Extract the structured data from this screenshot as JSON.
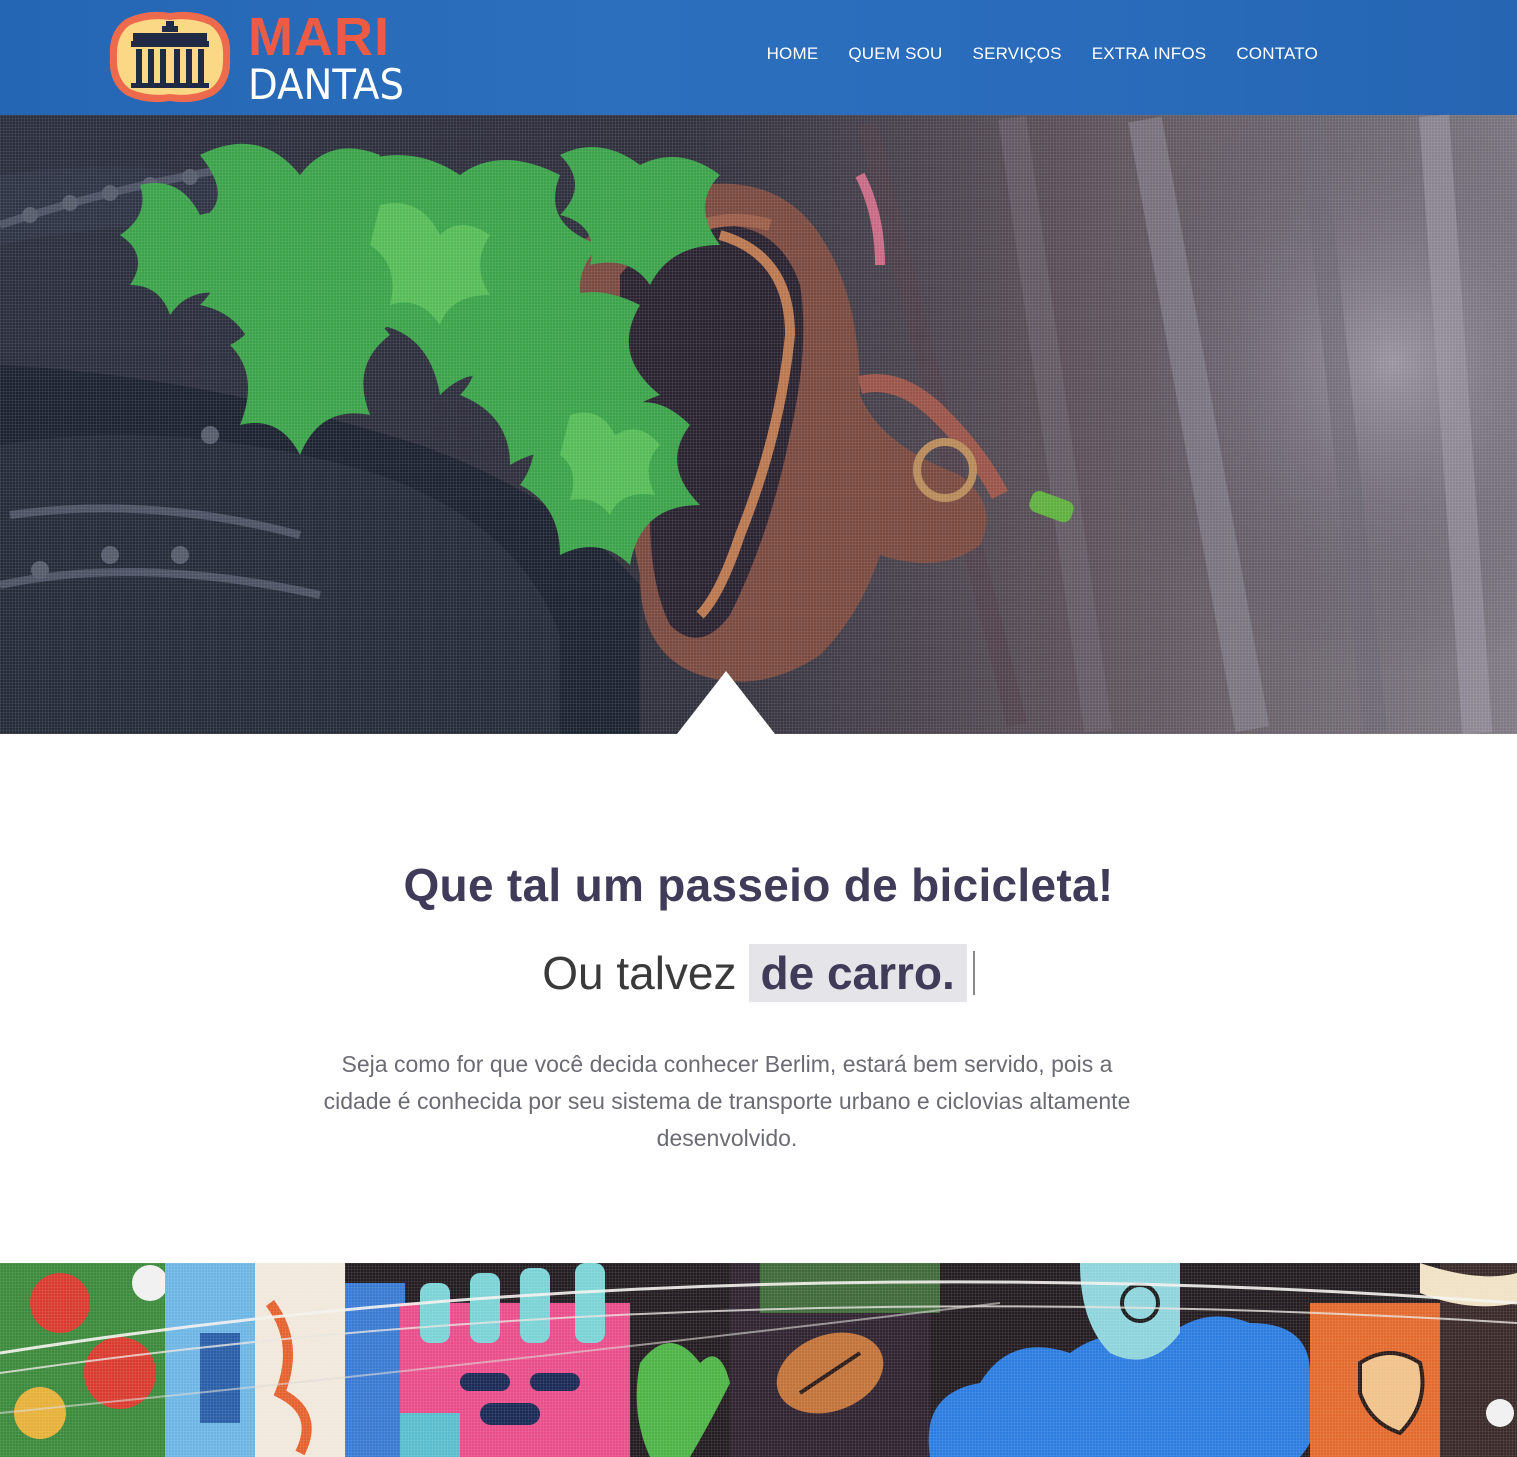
{
  "brand": {
    "name_top": "MARI",
    "name_bottom": "DANTAS",
    "logo_icon": "brandenburg-gate-icon",
    "colors": {
      "accent": "#ee5b45",
      "header_bg": "#2a6cbb",
      "badge_fill": "#fbd886",
      "heading": "#3f3b58"
    }
  },
  "nav": {
    "items": [
      {
        "label": "HOME"
      },
      {
        "label": "QUEM SOU"
      },
      {
        "label": "SERVIÇOS"
      },
      {
        "label": "EXTRA INFOS"
      },
      {
        "label": "CONTATO"
      }
    ]
  },
  "intro": {
    "title": "Que tal um passeio de bicicleta!",
    "sub_prefix": "Ou talvez",
    "sub_highlight": "de carro.",
    "body": "Seja como for que você decida conhecer Berlim, estará bem servido, pois a cidade é conhecida por seu sistema de transporte urbano e ciclovias altamente desenvolvido."
  }
}
